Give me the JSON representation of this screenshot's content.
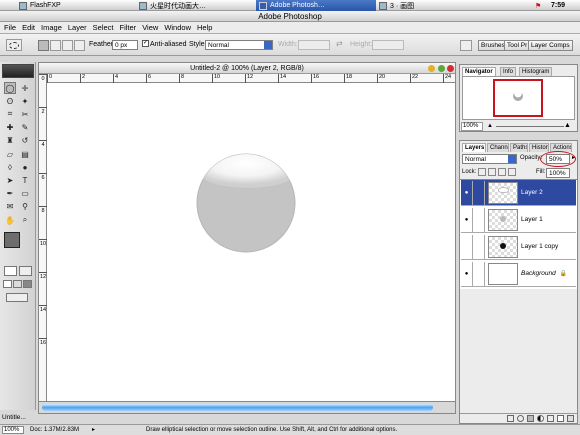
{
  "taskbar": {
    "apple": "",
    "items": [
      {
        "label": "FlashFXP",
        "active": false
      },
      {
        "label": "火星时代动画大…",
        "active": false
      },
      {
        "label": "Adobe Photosh…",
        "active": true
      },
      {
        "label": "3 · 画图",
        "active": false
      }
    ],
    "flag": "⚑",
    "clock": "7:59"
  },
  "app_title": "Adobe Photoshop",
  "menu": [
    "File",
    "Edit",
    "Image",
    "Layer",
    "Select",
    "Filter",
    "View",
    "Window",
    "Help"
  ],
  "options": {
    "feather_label": "Feather:",
    "feather_value": "0 px",
    "antialiased_label": "Anti-aliased",
    "antialiased_checked": true,
    "style_label": "Style:",
    "style_value": "Normal",
    "width_label": "Width:",
    "height_label": "Height:",
    "wells": [
      "Brushes",
      "Tool Pr",
      "Layer Comps"
    ]
  },
  "document": {
    "title": "Untitled-2 @ 100% (Layer 2, RGB/8)",
    "ruler_ticks": [
      "0",
      "2",
      "4",
      "6",
      "8",
      "10",
      "12",
      "14",
      "16",
      "18",
      "20",
      "22",
      "24"
    ],
    "ruler_vticks": [
      "0",
      "2",
      "4",
      "6",
      "8",
      "10",
      "12",
      "14",
      "16"
    ]
  },
  "colors": {
    "foreground": "#6d6d6d",
    "background": "#bfb8a6",
    "accent_selected": "#2d4aa0",
    "marker_red": "#c8141e"
  },
  "navigator": {
    "tabs": [
      "Navigator",
      "Info",
      "Histogram"
    ],
    "zoom": "100%"
  },
  "layers_panel": {
    "tabs": [
      "Layers",
      "Channels",
      "Paths",
      "History",
      "Actions"
    ],
    "blend_mode": "Normal",
    "opacity_label": "Opacity:",
    "opacity_value": "50%",
    "lock_label": "Lock:",
    "fill_label": "Fill:",
    "fill_value": "100%",
    "layers": [
      {
        "name": "Layer 2",
        "visible": true,
        "selected": true
      },
      {
        "name": "Layer 1",
        "visible": true,
        "selected": false
      },
      {
        "name": "Layer 1 copy",
        "visible": false,
        "selected": false
      },
      {
        "name": "Background",
        "visible": true,
        "selected": false
      }
    ]
  },
  "minimized_doc": "Untitle...",
  "status": {
    "zoom": "100%",
    "doc_info": "Doc: 1.37M/2.83M",
    "hint": "Draw elliptical selection or move selection outline. Use Shift, Alt, and Ctrl for additional options."
  }
}
